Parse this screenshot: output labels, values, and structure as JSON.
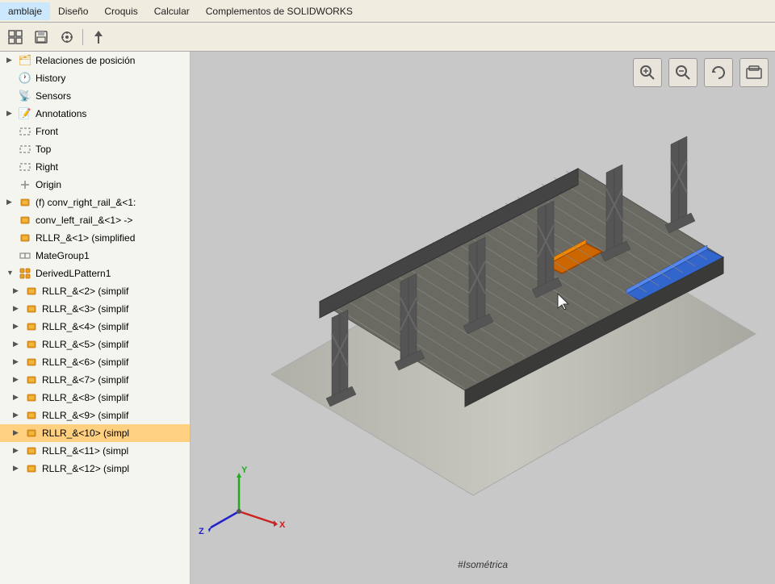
{
  "menubar": {
    "items": [
      "amblaje",
      "Diseño",
      "Croquis",
      "Calcular",
      "Complementos de SOLIDWORKS"
    ]
  },
  "toolbar": {
    "buttons": [
      "grid",
      "save",
      "target",
      "arrow"
    ]
  },
  "sidebar": {
    "items": [
      {
        "id": "relations",
        "label": "Relaciones de posición",
        "indent": 0,
        "type": "folder",
        "expandable": true
      },
      {
        "id": "history",
        "label": "History",
        "indent": 0,
        "type": "history",
        "expandable": false
      },
      {
        "id": "sensors",
        "label": "Sensors",
        "indent": 0,
        "type": "sensor",
        "expandable": false
      },
      {
        "id": "annotations",
        "label": "Annotations",
        "indent": 0,
        "type": "annotation",
        "expandable": true
      },
      {
        "id": "front",
        "label": "Front",
        "indent": 0,
        "type": "plane",
        "expandable": false
      },
      {
        "id": "top",
        "label": "Top",
        "indent": 0,
        "type": "plane",
        "expandable": false
      },
      {
        "id": "right",
        "label": "Right",
        "indent": 0,
        "type": "plane",
        "expandable": false
      },
      {
        "id": "origin",
        "label": "Origin",
        "indent": 0,
        "type": "origin",
        "expandable": false
      },
      {
        "id": "conv_right",
        "label": "(f) conv_right_rail_&<1:",
        "indent": 0,
        "type": "part",
        "expandable": true
      },
      {
        "id": "conv_left",
        "label": "conv_left_rail_&<1> ->",
        "indent": 0,
        "type": "part",
        "expandable": false
      },
      {
        "id": "rllr1",
        "label": "RLLR_&<1> (simplified",
        "indent": 0,
        "type": "part",
        "expandable": false
      },
      {
        "id": "mategroup1",
        "label": "MateGroup1",
        "indent": 0,
        "type": "mate",
        "expandable": false
      },
      {
        "id": "derivedlpattern1",
        "label": "DerivedLPattern1",
        "indent": 0,
        "type": "pattern",
        "expandable": true
      },
      {
        "id": "rllr2",
        "label": "RLLR_&<2> (simplif",
        "indent": 1,
        "type": "part",
        "expandable": true
      },
      {
        "id": "rllr3",
        "label": "RLLR_&<3> (simplif",
        "indent": 1,
        "type": "part",
        "expandable": true
      },
      {
        "id": "rllr4",
        "label": "RLLR_&<4> (simplif",
        "indent": 1,
        "type": "part",
        "expandable": true
      },
      {
        "id": "rllr5",
        "label": "RLLR_&<5> (simplif",
        "indent": 1,
        "type": "part",
        "expandable": true
      },
      {
        "id": "rllr6",
        "label": "RLLR_&<6> (simplif",
        "indent": 1,
        "type": "part",
        "expandable": true
      },
      {
        "id": "rllr7",
        "label": "RLLR_&<7> (simplif",
        "indent": 1,
        "type": "part",
        "expandable": true
      },
      {
        "id": "rllr8",
        "label": "RLLR_&<8> (simplif",
        "indent": 1,
        "type": "part",
        "expandable": true
      },
      {
        "id": "rllr9",
        "label": "RLLR_&<9> (simplif",
        "indent": 1,
        "type": "part",
        "expandable": true
      },
      {
        "id": "rllr10",
        "label": "RLLR_&<10> (simpl",
        "indent": 1,
        "type": "part",
        "expandable": true,
        "selected": true
      },
      {
        "id": "rllr11",
        "label": "RLLR_&<11> (simpl",
        "indent": 1,
        "type": "part",
        "expandable": true
      },
      {
        "id": "rllr12",
        "label": "RLLR_&<12> (simpl",
        "indent": 1,
        "type": "part",
        "expandable": true
      }
    ]
  },
  "viewport": {
    "iso_label": "#Isométrica",
    "axis": {
      "x_label": "X",
      "y_label": "Y",
      "z_label": "Z"
    }
  },
  "colors": {
    "selected_bg": "#ffd080",
    "tree_hover": "#dce8f0",
    "part_icon": "#e8a020",
    "viewport_bg": "#c8c8c8"
  }
}
